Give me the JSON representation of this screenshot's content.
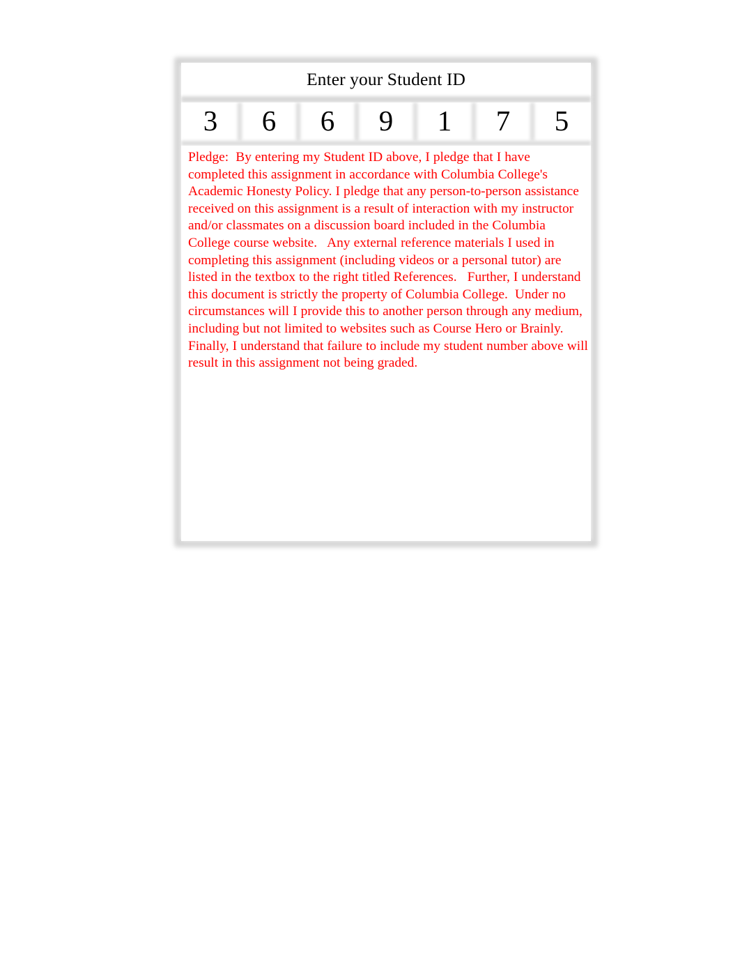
{
  "document": {
    "title": "Enter your Student ID"
  },
  "student_id": {
    "header_label": "Enter your Student ID",
    "digits": [
      "3",
      "6",
      "6",
      "9",
      "1",
      "7",
      "5"
    ],
    "value": "3669175"
  },
  "pledge": {
    "label": "Pledge:",
    "text": "Pledge:  By entering my Student ID above, I pledge that I have completed this assignment in accordance with Columbia College's Academic Honesty Policy. I pledge that any person-to-person assistance received on this assignment is a result of interaction with my instructor and/or classmates on a discussion board included in the Columbia College course website.   Any external reference materials I used in completing this assignment (including videos or a personal tutor) are listed in the textbox to the right titled References.   Further, I understand this document is strictly the property of Columbia College.  Under no circumstances will I provide this to another person through any medium, including but not limited to websites such as Course Hero or Brainly.   Finally, I understand that failure to include my student number above will result in this assignment not being graded."
  },
  "colors": {
    "pledge_text": "#ff0000",
    "header_text": "#000000",
    "digit_text": "#000000",
    "border": "#d2d2d2",
    "cell_background": "#ffffff",
    "page_background": "#ffffff"
  }
}
